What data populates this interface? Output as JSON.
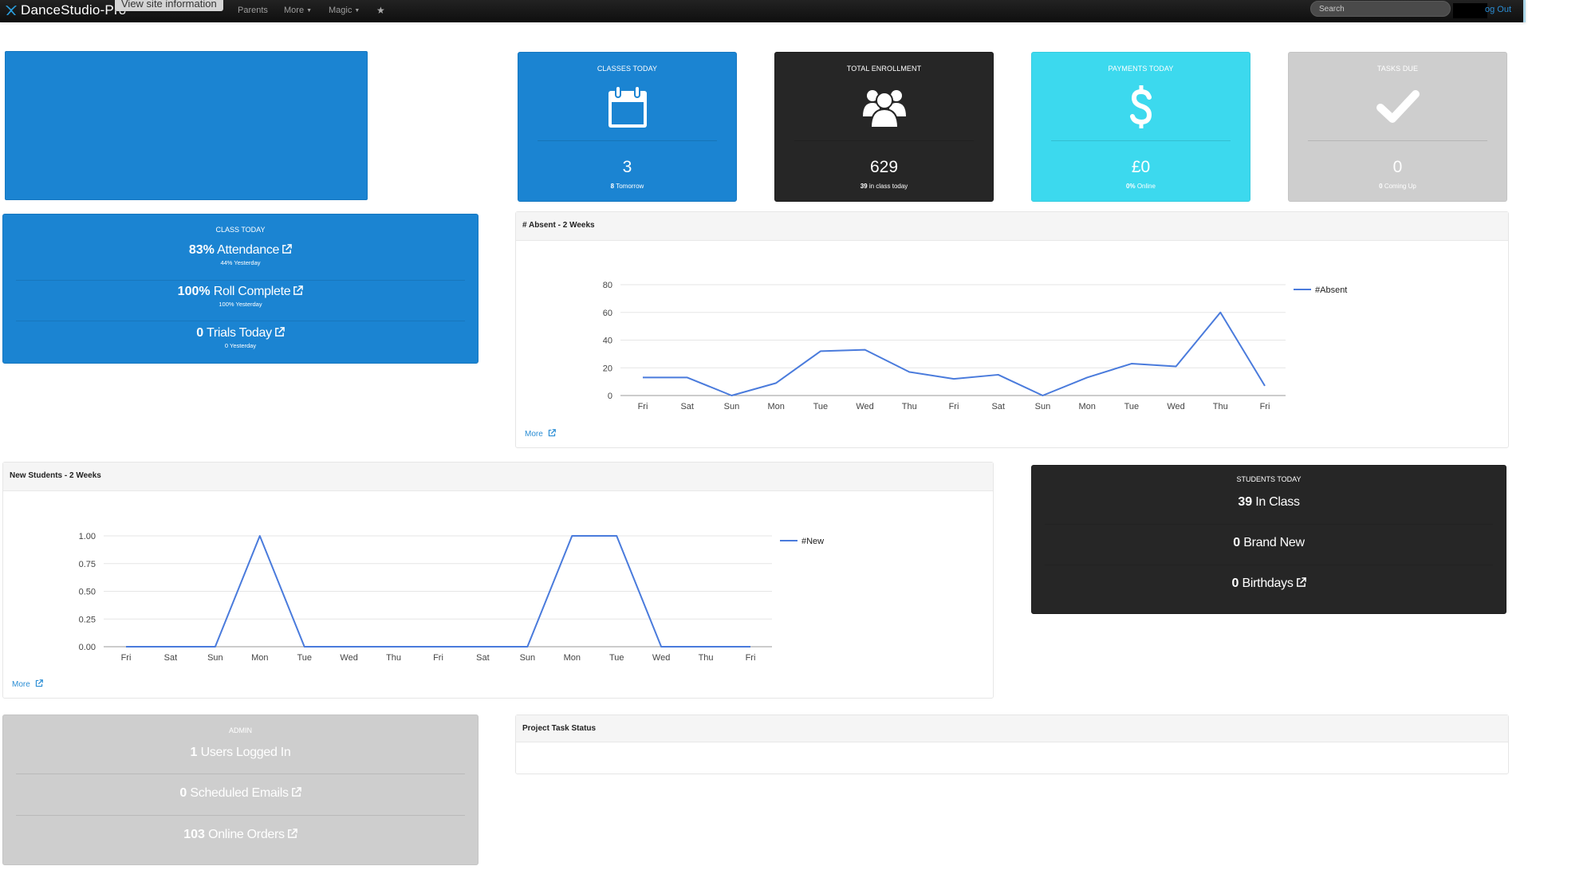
{
  "navbar": {
    "brand": "DanceStudio-Pro",
    "tooltip": "View site information",
    "items": [
      {
        "label": "Parents",
        "dropdown": false
      },
      {
        "label": "More",
        "dropdown": true
      },
      {
        "label": "Magic",
        "dropdown": true
      }
    ],
    "star_icon": "star-icon",
    "search_placeholder": "Search",
    "logout": "og Out"
  },
  "tiles": [
    {
      "title": "CLASSES TODAY",
      "icon": "calendar-icon",
      "value": "3",
      "sub_bold": "8",
      "sub_text": " Tomorrow",
      "color": "#1b84d2"
    },
    {
      "title": "TOTAL ENROLLMENT",
      "icon": "users-icon",
      "value": "629",
      "sub_bold": "39",
      "sub_text": " in class today",
      "color": "#262626"
    },
    {
      "title": "PAYMENTS TODAY",
      "icon": "dollar-icon",
      "value": "£0",
      "sub_bold": "0%",
      "sub_text": " Online",
      "color": "#3cd9ee"
    },
    {
      "title": "TASKS DUE",
      "icon": "check-icon",
      "value": "0",
      "sub_bold": "0",
      "sub_text": " Coming Up",
      "color": "#cecece"
    }
  ],
  "class_today": {
    "title": "CLASS TODAY",
    "rows": [
      {
        "bold": "83%",
        "label": " Attendance",
        "sub": "44% Yesterday",
        "link": true
      },
      {
        "bold": "100%",
        "label": " Roll Complete",
        "sub": "100% Yesterday",
        "link": true
      },
      {
        "bold": "0",
        "label": " Trials Today",
        "sub": "0 Yesterday",
        "link": true
      }
    ]
  },
  "students_today": {
    "title": "STUDENTS TODAY",
    "rows": [
      {
        "bold": "39",
        "label": " In Class",
        "link": false
      },
      {
        "bold": "0",
        "label": " Brand New",
        "link": false
      },
      {
        "bold": "0",
        "label": " Birthdays",
        "link": true
      }
    ]
  },
  "admin": {
    "title": "ADMIN",
    "rows": [
      {
        "bold": "1",
        "label": " Users Logged In",
        "link": false
      },
      {
        "bold": "0",
        "label": " Scheduled Emails",
        "link": true
      },
      {
        "bold": "103",
        "label": " Online Orders",
        "link": true
      }
    ]
  },
  "absent_card": {
    "title": "# Absent - 2 Weeks",
    "more": "More"
  },
  "new_students_card": {
    "title": "New Students - 2 Weeks",
    "more": "More"
  },
  "project_card": {
    "title": "Project Task Status"
  },
  "chart_data": [
    {
      "type": "line",
      "title": "# Absent - 2 Weeks",
      "categories": [
        "Fri",
        "Sat",
        "Sun",
        "Mon",
        "Tue",
        "Wed",
        "Thu",
        "Fri",
        "Sat",
        "Sun",
        "Mon",
        "Tue",
        "Wed",
        "Thu",
        "Fri"
      ],
      "series": [
        {
          "name": "#Absent",
          "values": [
            13,
            13,
            0,
            9,
            32,
            33,
            17,
            12,
            15,
            0,
            13,
            23,
            21,
            60,
            7
          ],
          "color": "#4a7bdc"
        }
      ],
      "yticks": [
        0,
        20,
        40,
        60,
        80
      ],
      "ytick_labels": [
        "0",
        "20",
        "40",
        "60",
        "80"
      ],
      "ylim": [
        0,
        80
      ],
      "xlabel": "",
      "ylabel": "",
      "grid": true,
      "legend": "right"
    },
    {
      "type": "line",
      "title": "New Students - 2 Weeks",
      "categories": [
        "Fri",
        "Sat",
        "Sun",
        "Mon",
        "Tue",
        "Wed",
        "Thu",
        "Fri",
        "Sat",
        "Sun",
        "Mon",
        "Tue",
        "Wed",
        "Thu",
        "Fri"
      ],
      "series": [
        {
          "name": "#New",
          "values": [
            0,
            0,
            0,
            1,
            0,
            0,
            0,
            0,
            0,
            0,
            1,
            1,
            0,
            0,
            0
          ],
          "color": "#4a7bdc"
        }
      ],
      "yticks": [
        0,
        0.25,
        0.5,
        0.75,
        1
      ],
      "ytick_labels": [
        "0.00",
        "0.25",
        "0.50",
        "0.75",
        "1.00"
      ],
      "ylim": [
        0,
        1
      ],
      "xlabel": "",
      "ylabel": "",
      "grid": true,
      "legend": "right"
    }
  ]
}
